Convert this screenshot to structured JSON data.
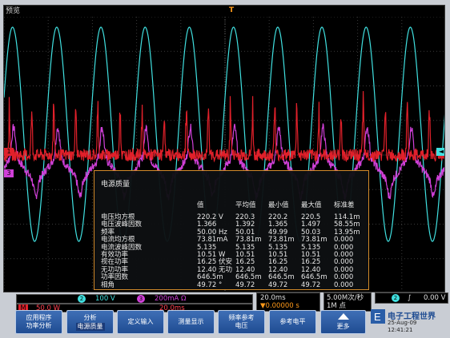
{
  "status": {
    "mode": "预览",
    "trigger_marker": "T",
    "ch1_marker": "1",
    "ch2_marker": "2",
    "ch3_marker": "3"
  },
  "colors": {
    "ch1": "#ffd21e",
    "ch2": "#40e0e0",
    "ch3": "#d040d8",
    "math": "#e0202a",
    "panel_border": "#d28a2a"
  },
  "chart_data": {
    "type": "line",
    "x_range_ms": [
      0,
      200
    ],
    "x_divisions": 10,
    "y_divisions": 8,
    "series": [
      {
        "color": "#40e0e0",
        "shape": "sine",
        "cycles": 10,
        "amplitude_div": 3.1,
        "offset_div": 0.6
      },
      {
        "color": "#d040d8",
        "shape": "spiky_current",
        "cycles": 10,
        "amplitude_div": 0.3,
        "offset_div": -0.4
      },
      {
        "color": "#e0202a",
        "shape": "noisy_pulse",
        "cycles": 20,
        "amplitude_div": 0.3,
        "offset_div": 0
      }
    ]
  },
  "stats": {
    "title": "电源质量",
    "headers": [
      "",
      "值",
      "平均值",
      "最小值",
      "最大值",
      "标准差"
    ],
    "rows": [
      [
        "电压均方根",
        "220.2 V",
        "220.3",
        "220.2",
        "220.5",
        "114.1m"
      ],
      [
        "电压波峰因数",
        "1.366",
        "1.392",
        "1.365",
        "1.497",
        "58.55m"
      ],
      [
        "频率",
        "50.00 Hz",
        "50.01",
        "49.99",
        "50.03",
        "13.95m"
      ],
      [
        "电流均方根",
        "73.81mA",
        "73.81m",
        "73.81m",
        "73.81m",
        "0.000"
      ],
      [
        "电流波峰因数",
        "5.135",
        "5.135",
        "5.135",
        "5.135",
        "0.000"
      ],
      [
        "有效功率",
        "10.51 W",
        "10.51",
        "10.51",
        "10.51",
        "0.000"
      ],
      [
        "视在功率",
        "16.25 伏安",
        "16.25",
        "16.25",
        "16.25",
        "0.000"
      ],
      [
        "无功功率",
        "12.40 无功",
        "12.40",
        "12.40",
        "12.40",
        "0.000"
      ],
      [
        "功率因数",
        "646.5m",
        "646.5m",
        "646.5m",
        "646.5m",
        "0.000"
      ],
      [
        "相角",
        "49.72 °",
        "49.72",
        "49.72",
        "49.72",
        "0.000"
      ]
    ]
  },
  "statusbar": {
    "ch2_label": "2",
    "ch2_scale": "100 V",
    "ch3_label": "3",
    "ch3_scale": "200mA Ω",
    "math_label": "M",
    "math_scale": "50.0 W",
    "math_time": "20.0ms",
    "timebase": "20.0ms",
    "trigger_pos": "▼0.00000 s",
    "sample_rate": "5.00M次/秒",
    "record_length": "1M 点",
    "trig_source": "2",
    "trig_slope": "∫",
    "trig_level": "0.00 V"
  },
  "softkeys": [
    {
      "line1": "应用程序",
      "line2": "功率分析"
    },
    {
      "line1": "分析",
      "line2": "电源质量"
    },
    {
      "line1": "定义输入",
      "line2": ""
    },
    {
      "line1": "测量显示",
      "line2": ""
    },
    {
      "line1": "频率参考",
      "line2": "电压"
    },
    {
      "line1": "参考电平",
      "line2": ""
    }
  ],
  "more_label": "更多",
  "watermark": {
    "brand": "电子工程世界",
    "date": "25-Aug-09",
    "time": "12:41:21"
  }
}
